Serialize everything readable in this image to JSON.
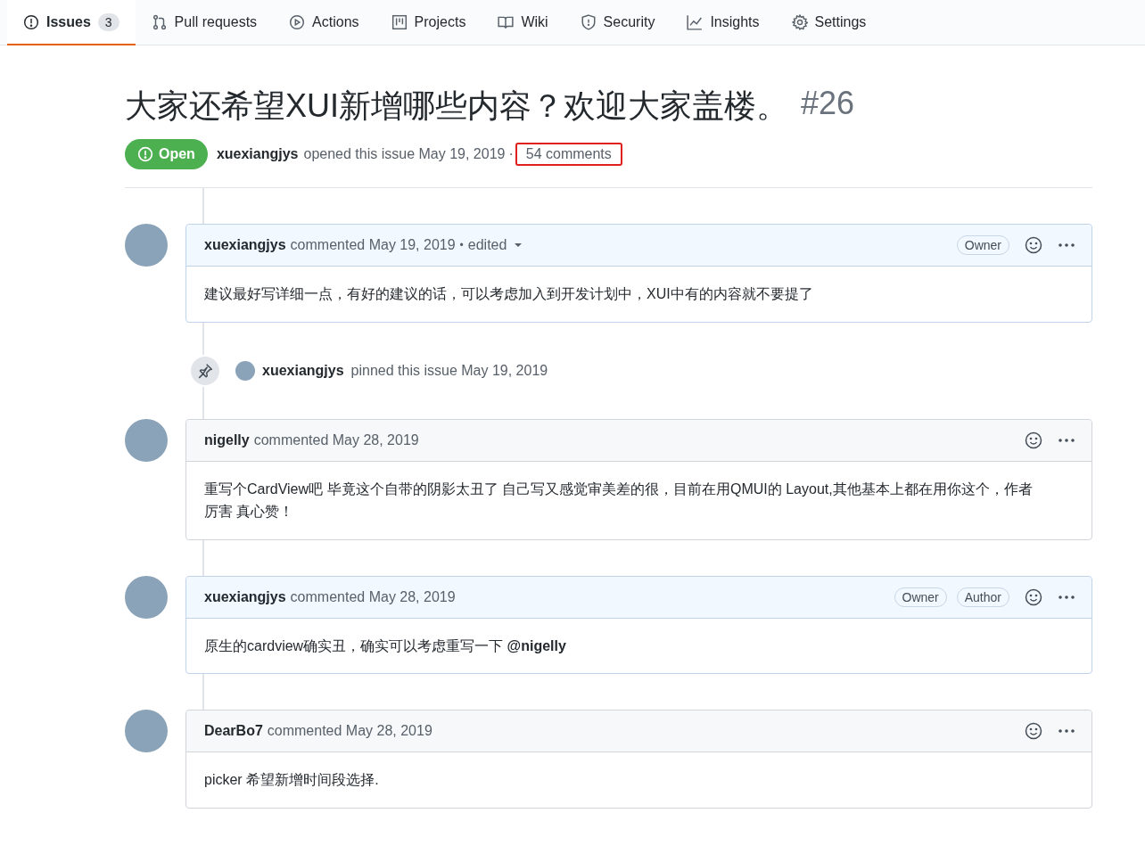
{
  "tabs": [
    {
      "label": "Issues",
      "count": "3",
      "selected": true
    },
    {
      "label": "Pull requests",
      "selected": false
    },
    {
      "label": "Actions",
      "selected": false
    },
    {
      "label": "Projects",
      "selected": false
    },
    {
      "label": "Wiki",
      "selected": false
    },
    {
      "label": "Security",
      "selected": false
    },
    {
      "label": "Insights",
      "selected": false
    },
    {
      "label": "Settings",
      "selected": false
    }
  ],
  "issue": {
    "title": "大家还希望XUI新增哪些内容？欢迎大家盖楼。",
    "number": "#26",
    "state": "Open",
    "author": "xuexiangjys",
    "meta": "opened this issue May 19, 2019",
    "separator": "·",
    "comments": "54 comments",
    "comments_highlighted": true
  },
  "timeline": [
    {
      "kind": "comment",
      "author": "xuexiangjys",
      "action": "commented May 19, 2019",
      "separator": "•",
      "edited": "edited",
      "highlighted": true,
      "badges": [
        "Owner"
      ],
      "body": "建议最好写详细一点，有好的建议的话，可以考虑加入到开发计划中，XUI中有的内容就不要提了"
    },
    {
      "kind": "event",
      "author": "xuexiangjys",
      "action": "pinned this issue May 19, 2019"
    },
    {
      "kind": "comment",
      "author": "nigelly",
      "action": "commented May 28, 2019",
      "highlighted": false,
      "body": "重写个CardView吧 毕竟这个自带的阴影太丑了 自己写又感觉审美差的很，目前在用QMUI的 Layout,其他基本上都在用你这个，作者厉害 真心赞！"
    },
    {
      "kind": "comment",
      "author": "xuexiangjys",
      "action": "commented May 28, 2019",
      "highlighted": true,
      "badges": [
        "Owner",
        "Author"
      ],
      "body": "原生的cardview确实丑，确实可以考虑重写一下 **@nigelly**"
    },
    {
      "kind": "comment",
      "author": "DearBo7",
      "action": "commented May 28, 2019",
      "highlighted": false,
      "body": "picker 希望新增时间段选择."
    }
  ]
}
